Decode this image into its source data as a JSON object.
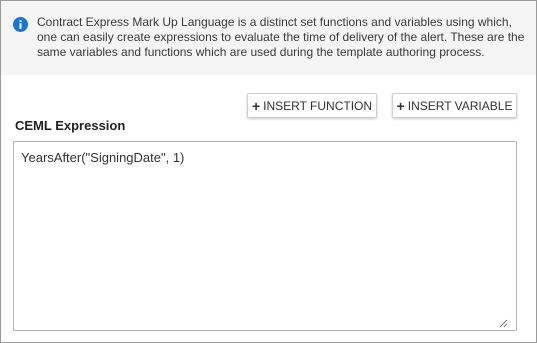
{
  "info": {
    "icon": "info-icon",
    "icon_color": "#1a73d9",
    "text": "Contract Express Mark Up Language is a distinct set functions and variables using which, one can easily create expressions to evaluate the time of delivery of the alert. These are the same variables and functions which are used during the template authoring process."
  },
  "toolbar": {
    "insert_function_label": "INSERT FUNCTION",
    "insert_variable_label": "INSERT VARIABLE",
    "plus_icon": "plus-icon"
  },
  "expression": {
    "label": "CEML Expression",
    "value": "YearsAfter(\"SigningDate\", 1)"
  }
}
